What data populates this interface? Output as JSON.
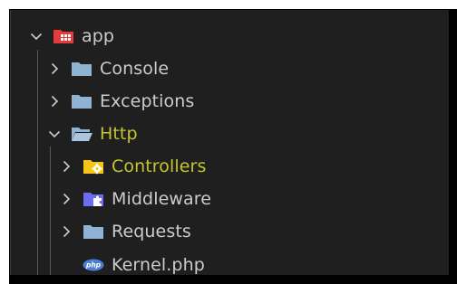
{
  "explorer": {
    "root": {
      "label": "app",
      "expanded": true,
      "icon": "folder-app-red-icon",
      "children": [
        {
          "label": "Console",
          "icon": "folder-icon",
          "expanded": false
        },
        {
          "label": "Exceptions",
          "icon": "folder-icon",
          "expanded": false
        },
        {
          "label": "Http",
          "icon": "folder-open-icon",
          "expanded": true,
          "git_modified": true,
          "children": [
            {
              "label": "Controllers",
              "icon": "folder-controllers-icon",
              "expanded": false,
              "git_modified": true
            },
            {
              "label": "Middleware",
              "icon": "folder-middleware-icon",
              "expanded": false
            },
            {
              "label": "Requests",
              "icon": "folder-icon",
              "expanded": false
            },
            {
              "label": "Kernel.php",
              "icon": "php-file-icon",
              "is_file": true
            }
          ]
        }
      ]
    }
  },
  "colors": {
    "background": "#1f1f1f",
    "text": "#cccccc",
    "git_modified_text": "#c5c52f",
    "folder": "#8fb4d3",
    "app_folder": "#e53b3b",
    "controllers_folder": "#f5c518",
    "middleware_folder": "#6c6cf0",
    "php_badge": "#4a7fd4",
    "indent_guide": "#585858"
  }
}
